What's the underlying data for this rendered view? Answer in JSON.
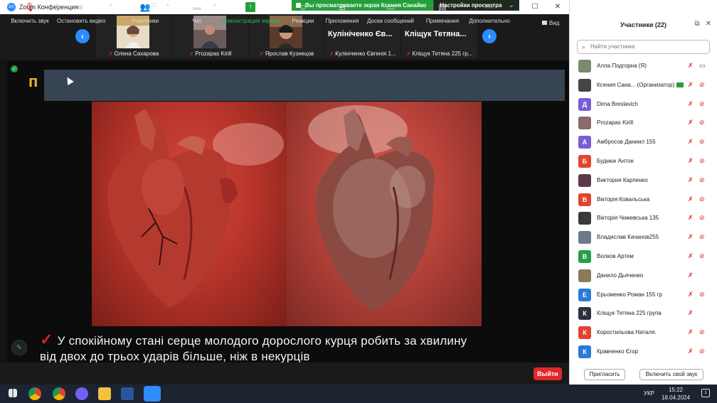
{
  "window": {
    "title": "Zoom Конференция",
    "logo": "zoom",
    "controls": [
      "minimize",
      "maximize",
      "close"
    ]
  },
  "share_banner": {
    "viewing_text": "Вы просматриваете экран Ксения Санайко",
    "view_options": "Настройки просмотра"
  },
  "thumbnails": [
    {
      "name": "Олена Сахарова",
      "muted": true
    },
    {
      "name": "Prozapas Kirill",
      "muted": true
    },
    {
      "name": "Ярослав Кузнецов",
      "muted": true
    },
    {
      "name": "Кулініченко Євгенія 1...",
      "big": "Кулініченко Єв...",
      "muted": true
    },
    {
      "name": "Кліщук Тетяна 225 гр...",
      "big": "Кліщук Тетяна...",
      "muted": true
    }
  ],
  "view_label": "Вид",
  "slide": {
    "caption_line1": "У спокійному стані серце молодого дорослого курця робить за хвилину",
    "caption_line2": "від двох до трьох ударів більше, ніж в некурців"
  },
  "toolbar": {
    "unmute": "Включить звук",
    "stop_video": "Остановить видео",
    "participants": "Участники",
    "participants_count": "22",
    "chat": "Чат",
    "share_screen": "Демонстрация экрана",
    "reactions": "Реакции",
    "apps": "Приложения",
    "whiteboards": "Доски сообщений",
    "notes": "Примечания",
    "more": "Дополнительно",
    "leave": "Выйти"
  },
  "panel": {
    "title": "Участники (22)",
    "search_placeholder": "Найти участника",
    "invite": "Пригласить",
    "unmute_me": "Включить свой звук",
    "participants": [
      {
        "name": "Алла Подгорна (Я)",
        "initial": "",
        "color": "#7a8a6a",
        "cam": "on"
      },
      {
        "name": "Ксения Сана... (Организатор)",
        "initial": "",
        "color": "#444444",
        "cam": "off",
        "badge": true
      },
      {
        "name": "Dima Breslavich",
        "initial": "Д",
        "color": "#7b5cd6",
        "cam": "off"
      },
      {
        "name": "Prozapas Kirill",
        "initial": "",
        "color": "#8a6a6a",
        "cam": "off"
      },
      {
        "name": "Амбросов Даниил 155",
        "initial": "А",
        "color": "#7b5cd6",
        "cam": "off"
      },
      {
        "name": "Буднюк Антон",
        "initial": "Б",
        "color": "#e0442e",
        "cam": "off"
      },
      {
        "name": "Виктория Карпенко",
        "initial": "",
        "color": "#5a3a4a",
        "cam": "off"
      },
      {
        "name": "Вікторія Ковальська",
        "initial": "В",
        "color": "#e0442e",
        "cam": "off"
      },
      {
        "name": "Вікторія Чижевська 135",
        "initial": "",
        "color": "#3a3a3a",
        "cam": "off"
      },
      {
        "name": "Владислав Качанов255",
        "initial": "",
        "color": "#6a7a8a",
        "cam": "off"
      },
      {
        "name": "Волков Артем",
        "initial": "В",
        "color": "#23a04a",
        "cam": "off"
      },
      {
        "name": "Данило Дьяченко",
        "initial": "",
        "color": "#8a7a5a",
        "cam": "none"
      },
      {
        "name": "Ерьоменко Роман 155 гр",
        "initial": "Е",
        "color": "#2a7bd6",
        "cam": "off"
      },
      {
        "name": "Кліщук Тетяна 225 група",
        "initial": "К",
        "color": "#2a3340",
        "cam": "none"
      },
      {
        "name": "Коростильова Наталя.",
        "initial": "К",
        "color": "#e0442e",
        "cam": "off"
      },
      {
        "name": "Кравченко Єгор",
        "initial": "К",
        "color": "#2a7bd6",
        "cam": "off"
      }
    ]
  },
  "taskbar": {
    "lang": "УКР",
    "time": "15:22",
    "date": "18.04.2024"
  }
}
